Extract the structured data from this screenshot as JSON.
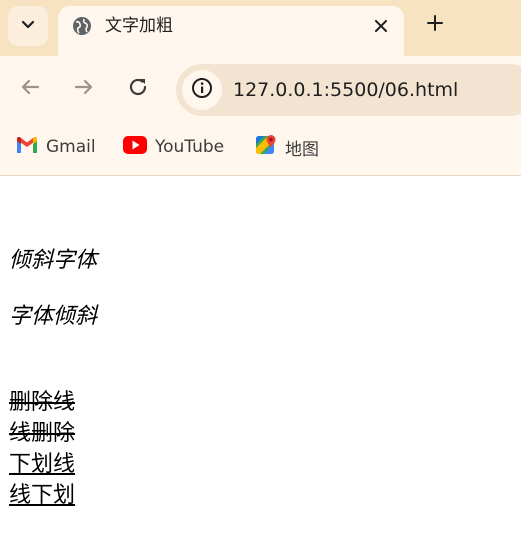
{
  "tab": {
    "title": "文字加粗"
  },
  "address_bar": {
    "url": "127.0.0.1:5500/06.html"
  },
  "bookmarks": [
    {
      "label": "Gmail",
      "icon": "gmail-icon"
    },
    {
      "label": "YouTube",
      "icon": "youtube-icon"
    },
    {
      "label": "地图",
      "icon": "maps-icon"
    }
  ],
  "page": {
    "lines": [
      {
        "text": "倾斜字体",
        "style": "italic"
      },
      {
        "text": "字体倾斜",
        "style": "italic"
      },
      {
        "text": "删除线",
        "style": "line-through"
      },
      {
        "text": "线删除",
        "style": "line-through"
      },
      {
        "text": "下划线",
        "style": "underline"
      },
      {
        "text": "线下划",
        "style": "underline"
      }
    ]
  },
  "colors": {
    "tabstrip": "#f7e2c1",
    "toolbar": "#fff7ee",
    "omnibox": "#f3e4d2",
    "youtube_red": "#ff0000"
  }
}
